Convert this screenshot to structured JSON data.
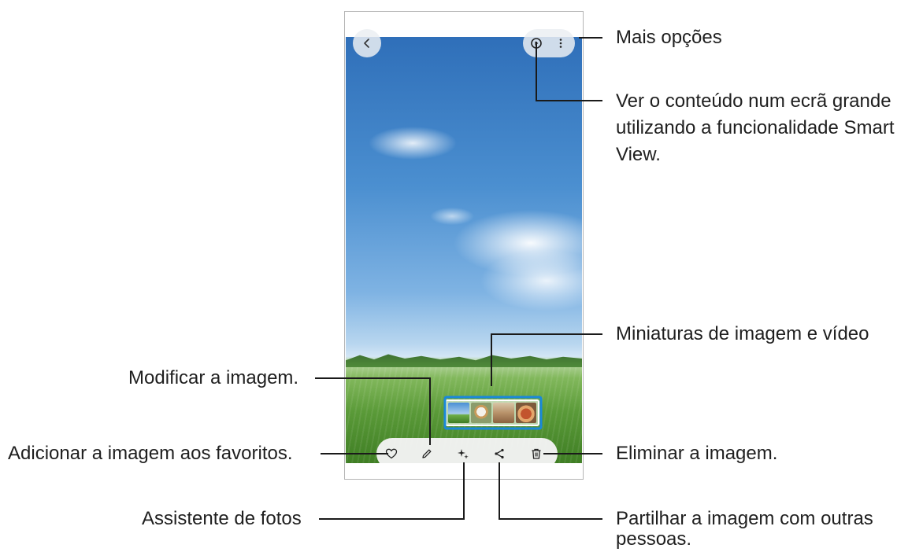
{
  "annotations": {
    "more_options": "Mais opções",
    "smart_view_line1": "Ver o conteúdo num ecrã grande",
    "smart_view_line2": "utilizando a funcionalidade Smart",
    "smart_view_line3": "View.",
    "thumbnails": "Miniaturas de imagem e vídeo",
    "edit": "Modificar a imagem.",
    "favorite": "Adicionar a imagem aos favoritos.",
    "delete": "Eliminar a imagem.",
    "assistant": "Assistente de fotos",
    "share_line1": "Partilhar a imagem com outras",
    "share_line2": "pessoas."
  },
  "icons": {
    "back": "chevron-left-icon",
    "smart_view": "smart-view-icon",
    "more": "more-vertical-icon",
    "favorite": "heart-icon",
    "edit": "pencil-icon",
    "assistant": "sparkle-icon",
    "share": "share-icon",
    "delete": "trash-icon"
  },
  "colors": {
    "callout_line": "#1a1a1a",
    "highlight_box": "#1a88d9"
  }
}
